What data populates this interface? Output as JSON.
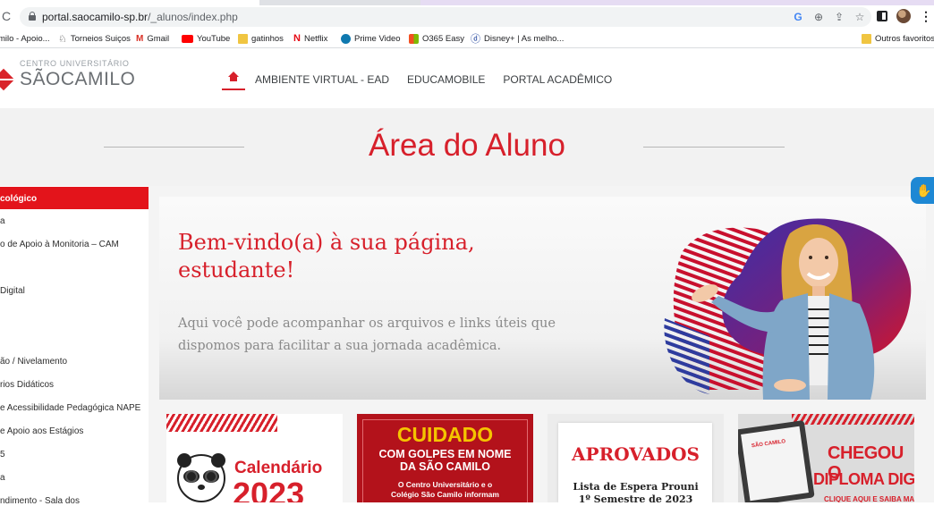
{
  "browser": {
    "url_host": "portal.saocamilo-sp.br",
    "url_path": "/_alunos/index.php",
    "bookmarks": [
      {
        "label": "milo - Apoio...",
        "icon": "site-icon"
      },
      {
        "label": "Torneios Suiços",
        "icon": "chess-icon"
      },
      {
        "label": "Gmail",
        "icon": "gmail-icon"
      },
      {
        "label": "YouTube",
        "icon": "youtube-icon"
      },
      {
        "label": "gatinhos",
        "icon": "folder-icon"
      },
      {
        "label": "Netflix",
        "icon": "netflix-icon"
      },
      {
        "label": "Prime Video",
        "icon": "prime-video-icon"
      },
      {
        "label": "O365 Easy",
        "icon": "office-icon"
      },
      {
        "label": "Disney+ | As melho...",
        "icon": "disney-icon"
      }
    ],
    "other_bookmarks": "Outros favoritos"
  },
  "site": {
    "logo_top": "CENTRO UNIVERSITÁRIO",
    "logo_name": "SÃOCAMILO",
    "nav": [
      "AMBIENTE VIRTUAL - EAD",
      "EDUCAMOBILE",
      "PORTAL ACADÊMICO"
    ],
    "page_title": "Área do Aluno"
  },
  "sidebar": {
    "active": "cológico",
    "items": [
      "a",
      "o de Apoio à Monitoria – CAM",
      "Digital",
      "ão / Nivelamento",
      "rios Didáticos",
      "e Acessibilidade Pedagógica NAPE",
      "e Apoio aos Estágios",
      "5",
      "a",
      "ndimento - Sala dos"
    ]
  },
  "hero": {
    "title": "Bem-vindo(a) à sua página, estudante!",
    "text": "Aqui você pode acompanhar os arquivos e links úteis que dispomos para facilitar a sua jornada acadêmica."
  },
  "cards": {
    "calendario": {
      "label": "Calendário",
      "year": "2023"
    },
    "cuidado": {
      "headline": "CUIDADO",
      "subhead": "COM GOLPES EM NOME DA SÃO CAMILO",
      "body": "O Centro Universitário e o Colégio São Camilo informam"
    },
    "aprovados": {
      "headline": "APROVADOS",
      "sub": "Lista de Espera Prouni",
      "sub2": "1º Semestre de 2023"
    },
    "diploma": {
      "headline": "CHEGOU O",
      "headline2": "DIPLOMA DIGITAL",
      "cta": "CLIQUE AQUI E SAIBA MAIS",
      "mini_logo": "SÃO CAMILO"
    }
  },
  "colors": {
    "brand_red": "#d7202b",
    "sidebar_active": "#e3141b",
    "a11y_blue": "#1e88d4"
  }
}
